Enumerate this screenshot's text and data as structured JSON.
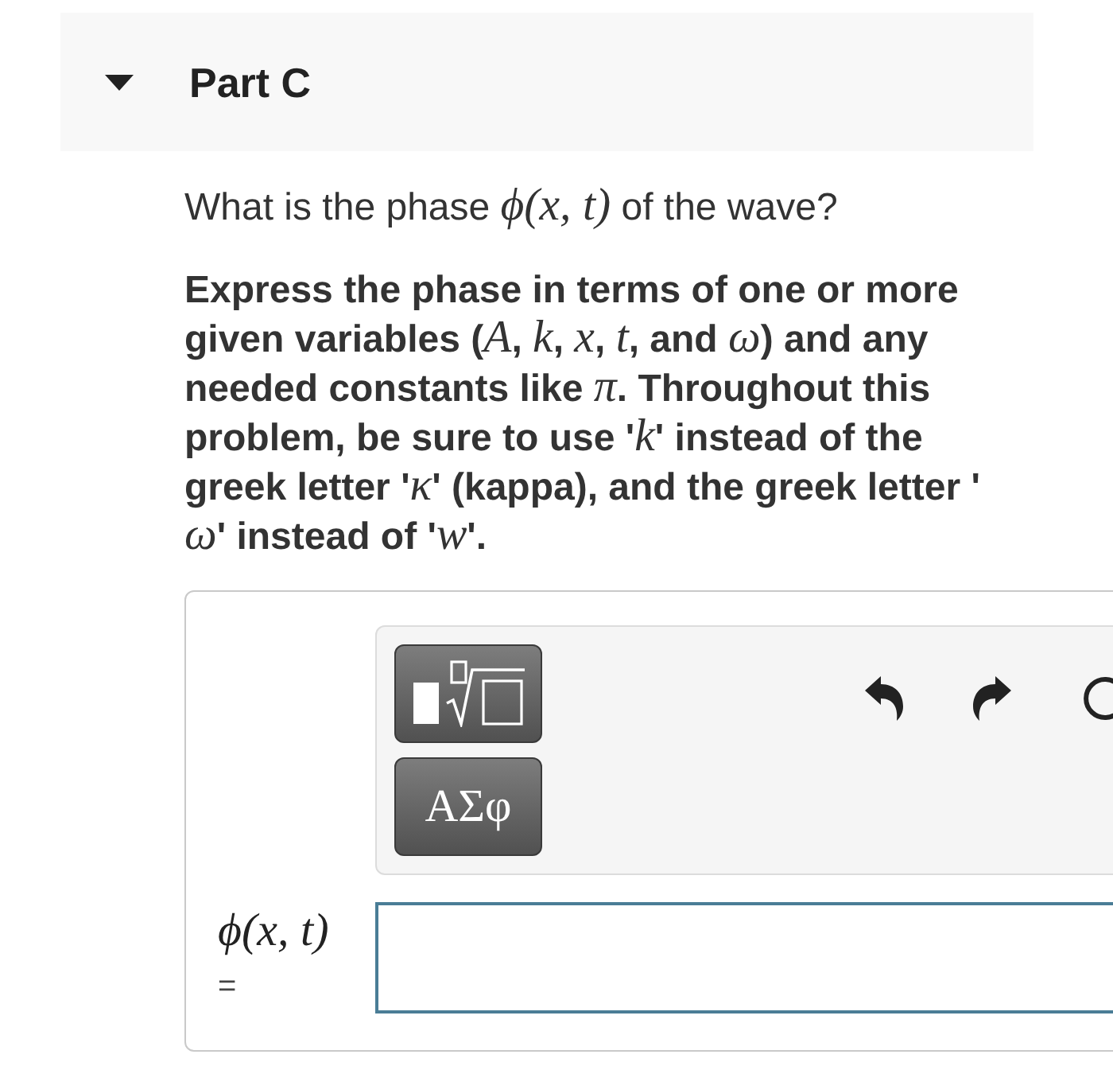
{
  "part": {
    "title": "Part C",
    "expanded": true
  },
  "question": [
    {
      "kind": "text",
      "text": "What is the phase "
    },
    {
      "kind": "math",
      "text": "ϕ(x, t)"
    },
    {
      "kind": "text",
      "text": " of the wave?"
    }
  ],
  "instructions": [
    {
      "kind": "text",
      "text": "Express the phase in terms of one or more given variables ("
    },
    {
      "kind": "math",
      "text": "A"
    },
    {
      "kind": "text",
      "text": ", "
    },
    {
      "kind": "math",
      "text": "k"
    },
    {
      "kind": "text",
      "text": ", "
    },
    {
      "kind": "math",
      "text": "x"
    },
    {
      "kind": "text",
      "text": ", "
    },
    {
      "kind": "math",
      "text": "t"
    },
    {
      "kind": "text",
      "text": ", and "
    },
    {
      "kind": "math",
      "text": "ω"
    },
    {
      "kind": "text",
      "text": ") and any needed constants like "
    },
    {
      "kind": "math",
      "text": "π"
    },
    {
      "kind": "text",
      "text": ". Throughout this problem, be sure to use '"
    },
    {
      "kind": "math",
      "text": "k"
    },
    {
      "kind": "text",
      "text": "' instead of the greek letter '"
    },
    {
      "kind": "math",
      "text": "κ"
    },
    {
      "kind": "text",
      "text": "' (kappa), and the greek letter '"
    },
    {
      "kind": "math",
      "text": "ω"
    },
    {
      "kind": "text",
      "text": "' instead of '"
    },
    {
      "kind": "math",
      "text": "w"
    },
    {
      "kind": "text",
      "text": "'."
    }
  ],
  "toolbar": {
    "buttons": [
      {
        "kind": "template"
      },
      {
        "kind": "greek",
        "label": "ΑΣφ"
      }
    ],
    "actions": [
      {
        "kind": "undo"
      },
      {
        "kind": "redo"
      },
      {
        "kind": "reset"
      }
    ]
  },
  "answer": {
    "label": "ϕ(x, t)",
    "equals": "="
  }
}
